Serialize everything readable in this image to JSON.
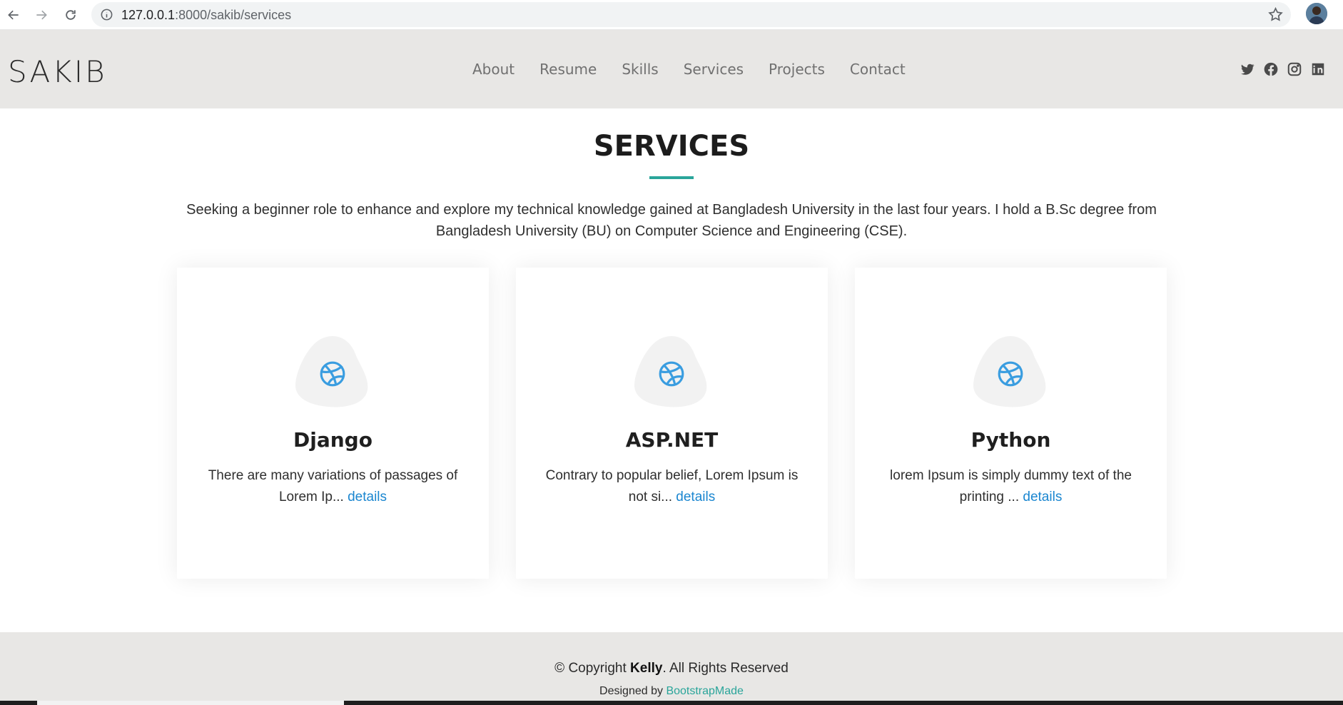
{
  "browser": {
    "url_host": "127.0.0.1",
    "url_path": ":8000/sakib/services"
  },
  "header": {
    "logo": "SAKIB",
    "nav": [
      "About",
      "Resume",
      "Skills",
      "Services",
      "Projects",
      "Contact"
    ],
    "social_icons": [
      "twitter-icon",
      "facebook-icon",
      "instagram-icon",
      "linkedin-icon"
    ]
  },
  "section": {
    "title": "SERVICES",
    "description": "Seeking a beginner role to enhance and explore my technical knowledge gained at Bangladesh University in the last four years. I hold a B.Sc degree from Bangladesh University (BU) on Computer Science and Engineering (CSE).",
    "accent_color": "#2aa59a"
  },
  "services": [
    {
      "title": "Django",
      "text": "There are many variations of passages of Lorem Ip...",
      "link": "details",
      "icon": "dribbble-icon"
    },
    {
      "title": "ASP.NET",
      "text": "Contrary to popular belief, Lorem Ipsum is not si...",
      "link": "details",
      "icon": "dribbble-icon"
    },
    {
      "title": "Python",
      "text": "lorem Ipsum is simply dummy text of the printing ...",
      "link": "details",
      "icon": "dribbble-icon"
    }
  ],
  "footer": {
    "copyright_prefix": "© Copyright ",
    "copyright_name": "Kelly",
    "copyright_suffix": ". All Rights Reserved",
    "credits_prefix": "Designed by ",
    "credits_link": "BootstrapMade"
  }
}
